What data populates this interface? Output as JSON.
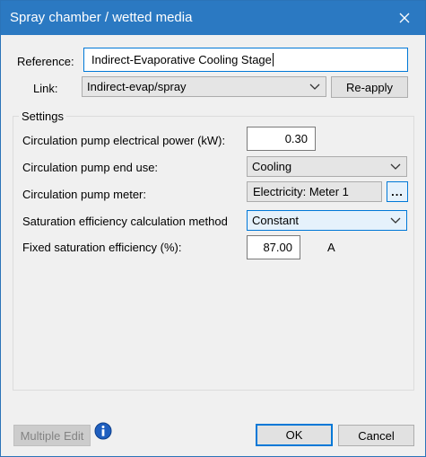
{
  "window": {
    "title": "Spray chamber / wetted media"
  },
  "reference": {
    "label": "Reference:",
    "value": "Indirect-Evaporative Cooling Stage"
  },
  "link": {
    "label": "Link:",
    "value": "Indirect-evap/spray",
    "reapply_label": "Re-apply"
  },
  "settings": {
    "group_label": "Settings",
    "pump_power": {
      "label": "Circulation pump electrical power (kW):",
      "value": "0.30"
    },
    "pump_end_use": {
      "label": "Circulation pump end use:",
      "value": "Cooling"
    },
    "pump_meter": {
      "label": "Circulation pump meter:",
      "value": "Electricity: Meter 1",
      "browse_label": "..."
    },
    "sat_method": {
      "label": "Saturation efficiency calculation method",
      "value": "Constant"
    },
    "fixed_sat": {
      "label": "Fixed saturation efficiency (%):",
      "value": "87.00",
      "flag": "A"
    }
  },
  "footer": {
    "multiple_edit_label": "Multiple Edit",
    "ok_label": "OK",
    "cancel_label": "Cancel"
  },
  "colors": {
    "titlebar": "#2b79c2",
    "accent": "#0078d7",
    "info_icon": "#1f5fbf"
  },
  "icons": {
    "close": "close-icon",
    "dropdown": "chevron-down-icon",
    "info": "info-icon"
  }
}
